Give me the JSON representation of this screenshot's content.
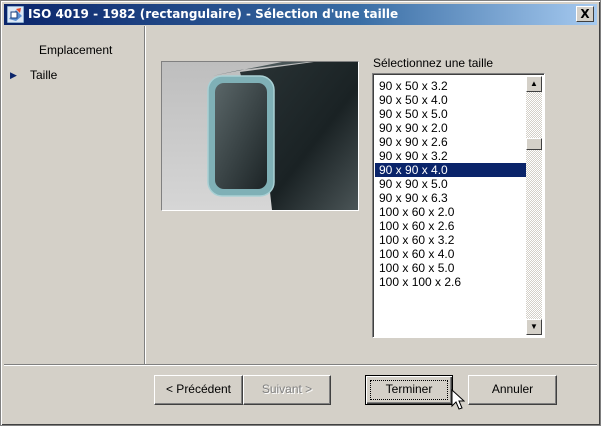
{
  "window": {
    "title": "ISO 4019 - 1982 (rectangulaire) - Sélection d'une taille",
    "close_label": "X"
  },
  "nav": {
    "items": [
      {
        "label": "Emplacement",
        "active": false
      },
      {
        "label": "Taille",
        "active": true
      }
    ]
  },
  "main": {
    "size_label": "Sélectionnez une taille",
    "sizes": [
      "90 x 50 x 3.2",
      "90 x 50 x 4.0",
      "90 x 50 x 5.0",
      "90 x 90 x 2.0",
      "90 x 90 x 2.6",
      "90 x 90 x 3.2",
      "90 x 90 x 4.0",
      "90 x 90 x 5.0",
      "90 x 90 x 6.3",
      "100 x 60 x 2.0",
      "100 x 60 x 2.6",
      "100 x 60 x 3.2",
      "100 x 60 x 4.0",
      "100 x 60 x 5.0",
      "100 x 100 x 2.6"
    ],
    "selected_size": "90 x 90 x 4.0"
  },
  "buttons": {
    "prev": "< Précédent",
    "next": "Suivant >",
    "finish": "Terminer",
    "cancel": "Annuler"
  },
  "icons": {
    "window_icon": "app-icon",
    "nav_arrow": "triangle-right-icon",
    "scroll_up": "scroll-up-arrow-icon",
    "scroll_down": "scroll-down-arrow-icon",
    "cursor": "mouse-pointer-icon"
  },
  "colors": {
    "titlebar": "#0a246a",
    "selection": "#0a246a",
    "face": "#d4d0c8"
  }
}
